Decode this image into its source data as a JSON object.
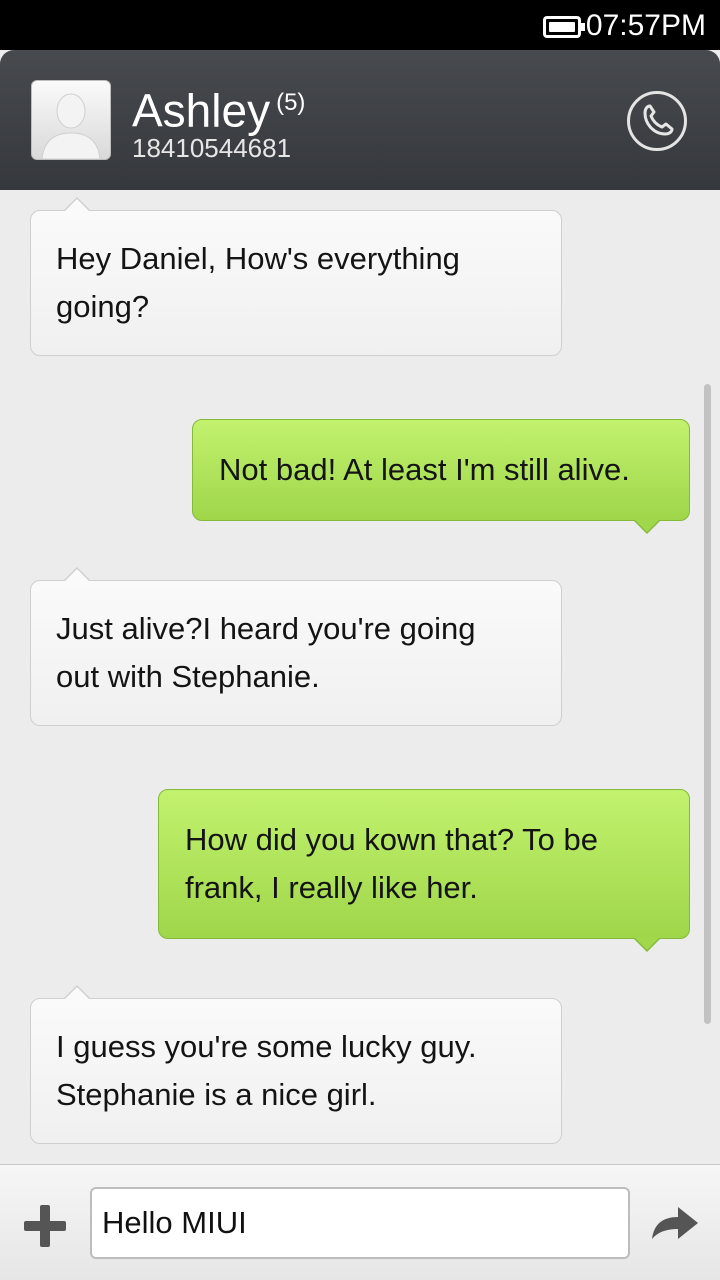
{
  "status_bar": {
    "time": "07:57PM",
    "battery_icon": "battery-icon"
  },
  "header": {
    "contact_name": "Ashley",
    "message_count": "(5)",
    "phone_number": "18410544681",
    "avatar_icon": "person-silhouette-icon",
    "call_icon": "phone-icon"
  },
  "messages": [
    {
      "direction": "incoming",
      "text": [
        "Hey Daniel, How's everything",
        "going?"
      ]
    },
    {
      "direction": "outgoing",
      "text": [
        "Not bad! At least I'm still alive."
      ]
    },
    {
      "direction": "incoming",
      "text": [
        "Just  alive?I heard you're going",
        "out with Stephanie."
      ]
    },
    {
      "direction": "outgoing",
      "text": [
        "How did you kown that? To be",
        "frank, I really like her."
      ]
    },
    {
      "direction": "incoming",
      "text": [
        "I guess you're some lucky guy.",
        "Stephanie is a nice girl."
      ]
    }
  ],
  "compose": {
    "input_value": "Hello MIUI",
    "add_icon": "plus-icon",
    "send_icon": "send-arrow-icon"
  },
  "colors": {
    "header": "#3e4145",
    "incoming_bubble": "#f5f5f5",
    "outgoing_bubble": "#aee05a",
    "background": "#ececec"
  }
}
